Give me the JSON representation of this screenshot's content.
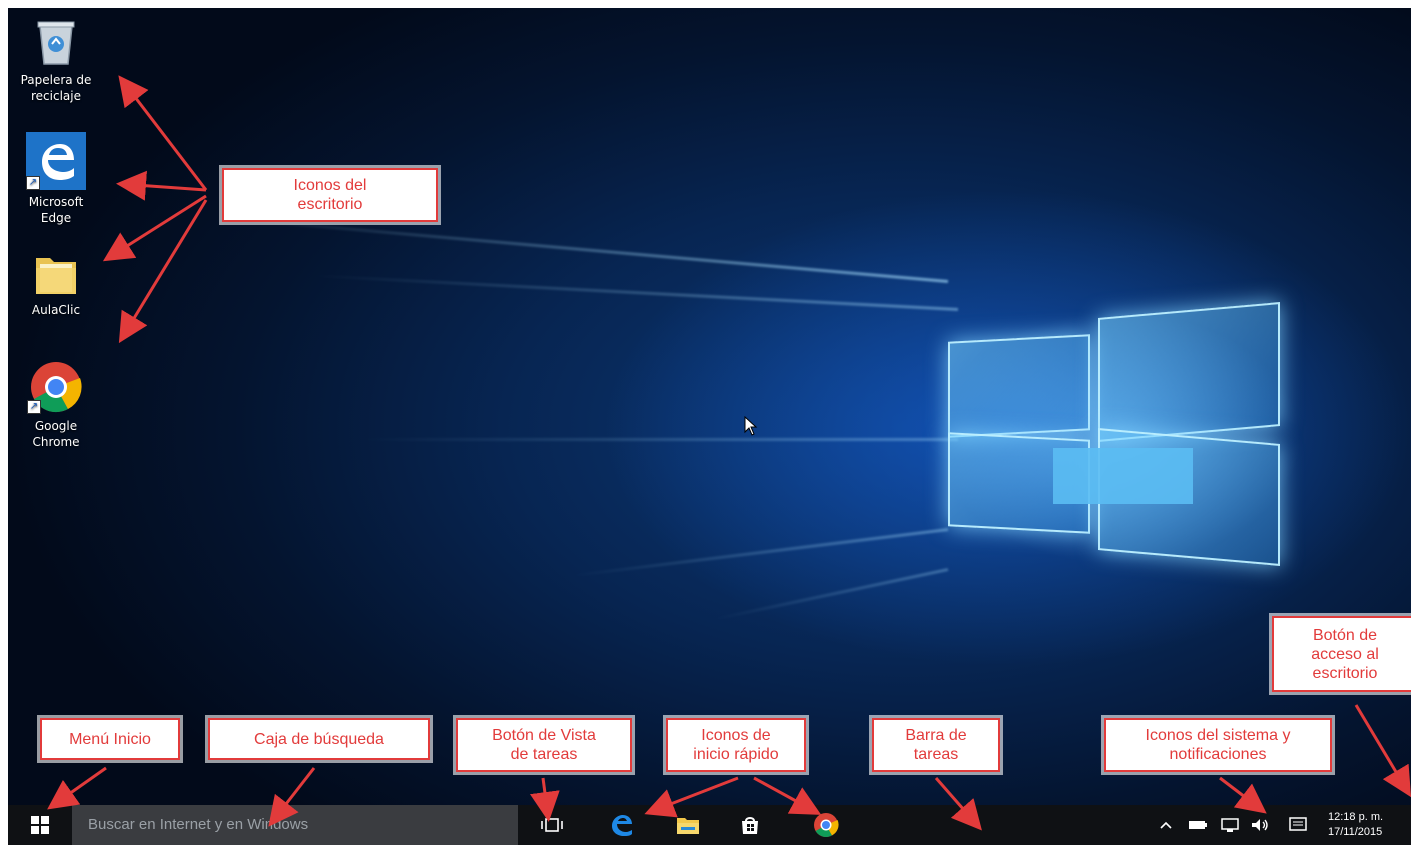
{
  "desktop": {
    "icons": [
      {
        "label_l1": "Papelera de",
        "label_l2": "reciclaje",
        "icon": "recycle-bin-icon"
      },
      {
        "label_l1": "Microsoft",
        "label_l2": "Edge",
        "icon": "edge-icon"
      },
      {
        "label_l1": "AulaClic",
        "label_l2": "",
        "icon": "folder-icon"
      },
      {
        "label_l1": "Google",
        "label_l2": "Chrome",
        "icon": "chrome-icon"
      }
    ]
  },
  "callouts": {
    "desktop_icons": {
      "l1": "Iconos del",
      "l2": "escritorio"
    },
    "show_desktop": {
      "l1": "Botón de",
      "l2": "acceso al",
      "l3": "escritorio"
    },
    "start_menu": {
      "l1": "Menú Inicio"
    },
    "search_box": {
      "l1": "Caja de búsqueda"
    },
    "task_view": {
      "l1": "Botón de Vista",
      "l2": "de tareas"
    },
    "quick_launch": {
      "l1": "Iconos de",
      "l2": "inicio rápido"
    },
    "taskbar": {
      "l1": "Barra de",
      "l2": "tareas"
    },
    "system_icons": {
      "l1": "Iconos del sistema y",
      "l2": "notificaciones"
    }
  },
  "taskbar": {
    "search_placeholder": "Buscar en Internet y en Windows",
    "time": "12:18 p. m.",
    "date": "17/11/2015"
  },
  "colors": {
    "callout_red": "#e23b3b",
    "taskbar_bg": "#0f1114",
    "search_bg": "#3a3c40",
    "edge_blue": "#1e73c8",
    "folder_yellow": "#f3d36b"
  }
}
